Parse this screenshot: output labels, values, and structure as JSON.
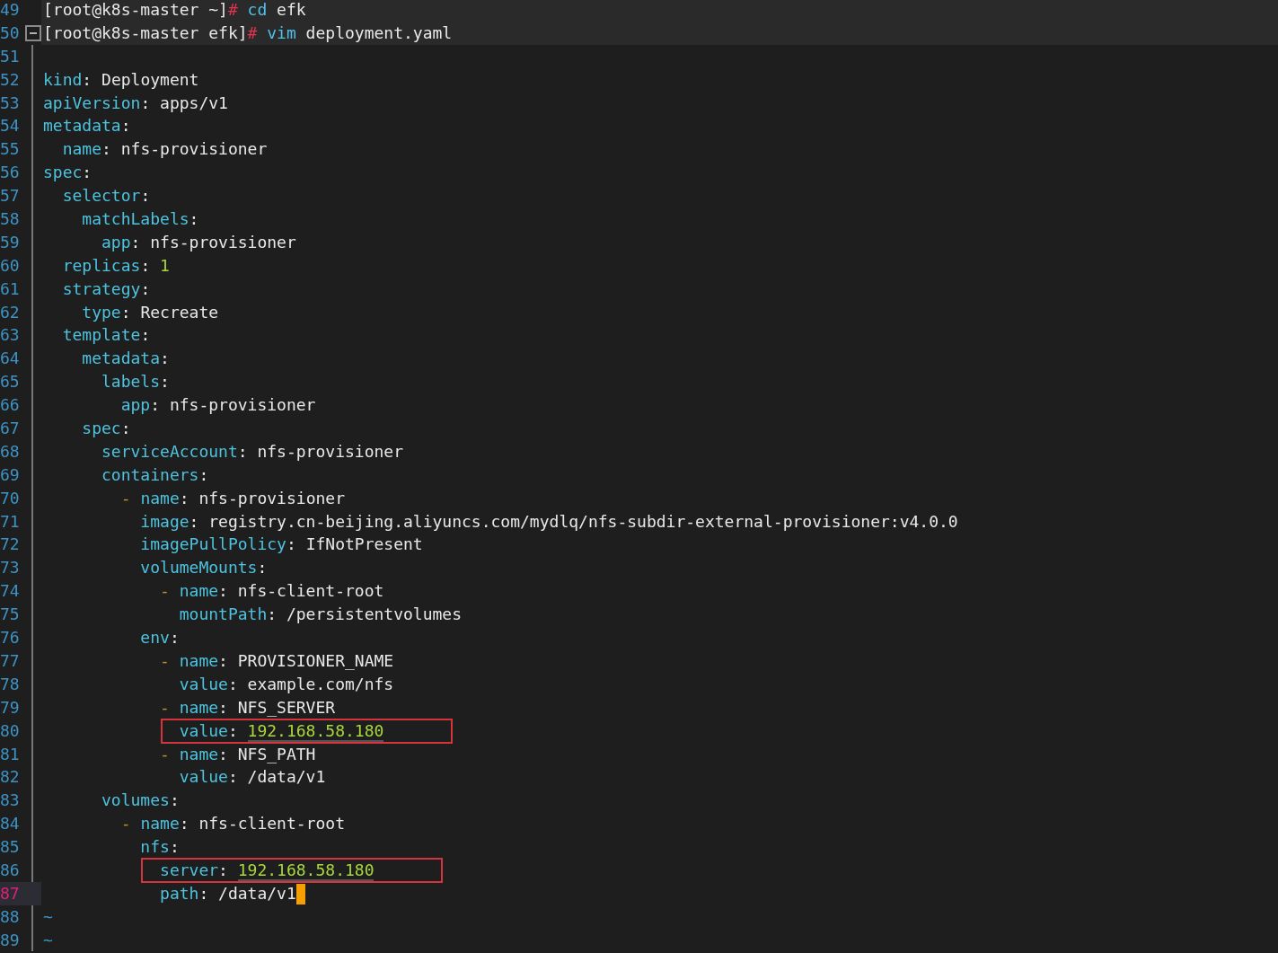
{
  "lines": [
    {
      "number": "49",
      "kind": "shell",
      "s": [
        {
          "kind": "plain",
          "text": "[root@k8s-master ~]"
        },
        {
          "kind": "prompt",
          "text": "# "
        },
        {
          "kind": "cmd",
          "text": "cd"
        },
        {
          "kind": "plain",
          "text": " efk"
        }
      ]
    },
    {
      "number": "50",
      "kind": "shell",
      "fold": true,
      "s": [
        {
          "kind": "plain",
          "text": "[root@k8s-master efk]"
        },
        {
          "kind": "prompt",
          "text": "# "
        },
        {
          "kind": "cmd",
          "text": "vim"
        },
        {
          "kind": "plain",
          "text": " deployment.yaml"
        }
      ]
    },
    {
      "number": "51",
      "kind": "code"
    },
    {
      "number": "52",
      "kind": "code",
      "s": [
        {
          "kind": "key",
          "text": "kind"
        },
        {
          "kind": "punct",
          "text": ": "
        },
        {
          "kind": "value",
          "text": "Deployment"
        }
      ]
    },
    {
      "number": "53",
      "kind": "code",
      "s": [
        {
          "kind": "key",
          "text": "apiVersion"
        },
        {
          "kind": "punct",
          "text": ": "
        },
        {
          "kind": "value",
          "text": "apps/v1"
        }
      ]
    },
    {
      "number": "54",
      "kind": "code",
      "s": [
        {
          "kind": "key",
          "text": "metadata"
        },
        {
          "kind": "punct",
          "text": ":"
        }
      ]
    },
    {
      "number": "55",
      "kind": "code",
      "s": [
        {
          "kind": "key",
          "text": "  name"
        },
        {
          "kind": "punct",
          "text": ": "
        },
        {
          "kind": "value",
          "text": "nfs-provisioner"
        }
      ]
    },
    {
      "number": "56",
      "kind": "code",
      "s": [
        {
          "kind": "key",
          "text": "spec"
        },
        {
          "kind": "punct",
          "text": ":"
        }
      ]
    },
    {
      "number": "57",
      "kind": "code",
      "s": [
        {
          "kind": "key",
          "text": "  selector"
        },
        {
          "kind": "punct",
          "text": ":"
        }
      ]
    },
    {
      "number": "58",
      "kind": "code",
      "s": [
        {
          "kind": "key",
          "text": "    matchLabels"
        },
        {
          "kind": "punct",
          "text": ":"
        }
      ]
    },
    {
      "number": "59",
      "kind": "code",
      "s": [
        {
          "kind": "key",
          "text": "      app"
        },
        {
          "kind": "punct",
          "text": ": "
        },
        {
          "kind": "value",
          "text": "nfs-provisioner"
        }
      ]
    },
    {
      "number": "60",
      "kind": "code",
      "s": [
        {
          "kind": "key",
          "text": "  replicas"
        },
        {
          "kind": "punct",
          "text": ": "
        },
        {
          "kind": "num",
          "text": "1"
        }
      ]
    },
    {
      "number": "61",
      "kind": "code",
      "s": [
        {
          "kind": "key",
          "text": "  strategy"
        },
        {
          "kind": "punct",
          "text": ":"
        }
      ]
    },
    {
      "number": "62",
      "kind": "code",
      "s": [
        {
          "kind": "key",
          "text": "    type"
        },
        {
          "kind": "punct",
          "text": ": "
        },
        {
          "kind": "value",
          "text": "Recreate"
        }
      ]
    },
    {
      "number": "63",
      "kind": "code",
      "s": [
        {
          "kind": "key",
          "text": "  template"
        },
        {
          "kind": "punct",
          "text": ":"
        }
      ]
    },
    {
      "number": "64",
      "kind": "code",
      "s": [
        {
          "kind": "key",
          "text": "    metadata"
        },
        {
          "kind": "punct",
          "text": ":"
        }
      ]
    },
    {
      "number": "65",
      "kind": "code",
      "s": [
        {
          "kind": "key",
          "text": "      labels"
        },
        {
          "kind": "punct",
          "text": ":"
        }
      ]
    },
    {
      "number": "66",
      "kind": "code",
      "s": [
        {
          "kind": "key",
          "text": "        app"
        },
        {
          "kind": "punct",
          "text": ": "
        },
        {
          "kind": "value",
          "text": "nfs-provisioner"
        }
      ]
    },
    {
      "number": "67",
      "kind": "code",
      "s": [
        {
          "kind": "key",
          "text": "    spec"
        },
        {
          "kind": "punct",
          "text": ":"
        }
      ]
    },
    {
      "number": "68",
      "kind": "code",
      "s": [
        {
          "kind": "key",
          "text": "      serviceAccount"
        },
        {
          "kind": "punct",
          "text": ": "
        },
        {
          "kind": "value",
          "text": "nfs-provisioner"
        }
      ]
    },
    {
      "number": "69",
      "kind": "code",
      "s": [
        {
          "kind": "key",
          "text": "      containers"
        },
        {
          "kind": "punct",
          "text": ":"
        }
      ]
    },
    {
      "number": "70",
      "kind": "code",
      "s": [
        {
          "kind": "dash",
          "text": "        - "
        },
        {
          "kind": "key",
          "text": "name"
        },
        {
          "kind": "punct",
          "text": ": "
        },
        {
          "kind": "value",
          "text": "nfs-provisioner"
        }
      ]
    },
    {
      "number": "71",
      "kind": "code",
      "s": [
        {
          "kind": "key",
          "text": "          image"
        },
        {
          "kind": "punct",
          "text": ": "
        },
        {
          "kind": "value",
          "text": "registry.cn-beijing.aliyuncs.com/mydlq/nfs-subdir-external-provisioner:v4.0.0"
        }
      ]
    },
    {
      "number": "72",
      "kind": "code",
      "s": [
        {
          "kind": "key",
          "text": "          imagePullPolicy"
        },
        {
          "kind": "punct",
          "text": ": "
        },
        {
          "kind": "value",
          "text": "IfNotPresent"
        }
      ]
    },
    {
      "number": "73",
      "kind": "code",
      "s": [
        {
          "kind": "key",
          "text": "          volumeMounts"
        },
        {
          "kind": "punct",
          "text": ":"
        }
      ]
    },
    {
      "number": "74",
      "kind": "code",
      "s": [
        {
          "kind": "dash",
          "text": "            - "
        },
        {
          "kind": "key",
          "text": "name"
        },
        {
          "kind": "punct",
          "text": ": "
        },
        {
          "kind": "value",
          "text": "nfs-client-root"
        }
      ]
    },
    {
      "number": "75",
      "kind": "code",
      "s": [
        {
          "kind": "key",
          "text": "              mountPath"
        },
        {
          "kind": "punct",
          "text": ": "
        },
        {
          "kind": "value",
          "text": "/persistentvolumes"
        }
      ]
    },
    {
      "number": "76",
      "kind": "code",
      "s": [
        {
          "kind": "key",
          "text": "          env"
        },
        {
          "kind": "punct",
          "text": ":"
        }
      ]
    },
    {
      "number": "77",
      "kind": "code",
      "s": [
        {
          "kind": "dash",
          "text": "            - "
        },
        {
          "kind": "key",
          "text": "name"
        },
        {
          "kind": "punct",
          "text": ": "
        },
        {
          "kind": "value",
          "text": "PROVISIONER_NAME"
        }
      ]
    },
    {
      "number": "78",
      "kind": "code",
      "s": [
        {
          "kind": "key",
          "text": "              value"
        },
        {
          "kind": "punct",
          "text": ": "
        },
        {
          "kind": "value",
          "text": "example.com/nfs"
        }
      ]
    },
    {
      "number": "79",
      "kind": "code",
      "s": [
        {
          "kind": "dash",
          "text": "            - "
        },
        {
          "kind": "key",
          "text": "name"
        },
        {
          "kind": "punct",
          "text": ": "
        },
        {
          "kind": "value",
          "text": "NFS_SERVER"
        }
      ]
    },
    {
      "number": "80",
      "kind": "code",
      "highlighted": true,
      "s": [
        {
          "kind": "key",
          "text": "              value"
        },
        {
          "kind": "punct",
          "text": ": "
        },
        {
          "kind": "ip",
          "text": "192.168.58.180"
        }
      ]
    },
    {
      "number": "81",
      "kind": "code",
      "s": [
        {
          "kind": "dash",
          "text": "            - "
        },
        {
          "kind": "key",
          "text": "name"
        },
        {
          "kind": "punct",
          "text": ": "
        },
        {
          "kind": "value",
          "text": "NFS_PATH"
        }
      ]
    },
    {
      "number": "82",
      "kind": "code",
      "s": [
        {
          "kind": "key",
          "text": "              value"
        },
        {
          "kind": "punct",
          "text": ": "
        },
        {
          "kind": "value",
          "text": "/data/v1"
        }
      ]
    },
    {
      "number": "83",
      "kind": "code",
      "s": [
        {
          "kind": "key",
          "text": "      volumes"
        },
        {
          "kind": "punct",
          "text": ":"
        }
      ]
    },
    {
      "number": "84",
      "kind": "code",
      "s": [
        {
          "kind": "dash",
          "text": "        - "
        },
        {
          "kind": "key",
          "text": "name"
        },
        {
          "kind": "punct",
          "text": ": "
        },
        {
          "kind": "value",
          "text": "nfs-client-root"
        }
      ]
    },
    {
      "number": "85",
      "kind": "code",
      "s": [
        {
          "kind": "key",
          "text": "          nfs"
        },
        {
          "kind": "punct",
          "text": ":"
        }
      ]
    },
    {
      "number": "86",
      "kind": "code",
      "highlighted": true,
      "s": [
        {
          "kind": "key",
          "text": "            server"
        },
        {
          "kind": "punct",
          "text": ": "
        },
        {
          "kind": "ip",
          "text": "192.168.58.180"
        }
      ]
    },
    {
      "number": "87",
      "kind": "code",
      "current": true,
      "cursor": true,
      "s": [
        {
          "kind": "key",
          "text": "            path"
        },
        {
          "kind": "punct",
          "text": ": "
        },
        {
          "kind": "value",
          "text": "/data/v1"
        }
      ]
    },
    {
      "number": "88",
      "kind": "code",
      "s": [
        {
          "kind": "tilde",
          "text": "~"
        }
      ]
    },
    {
      "number": "89",
      "kind": "code",
      "s": [
        {
          "kind": "tilde",
          "text": "~"
        }
      ]
    }
  ]
}
